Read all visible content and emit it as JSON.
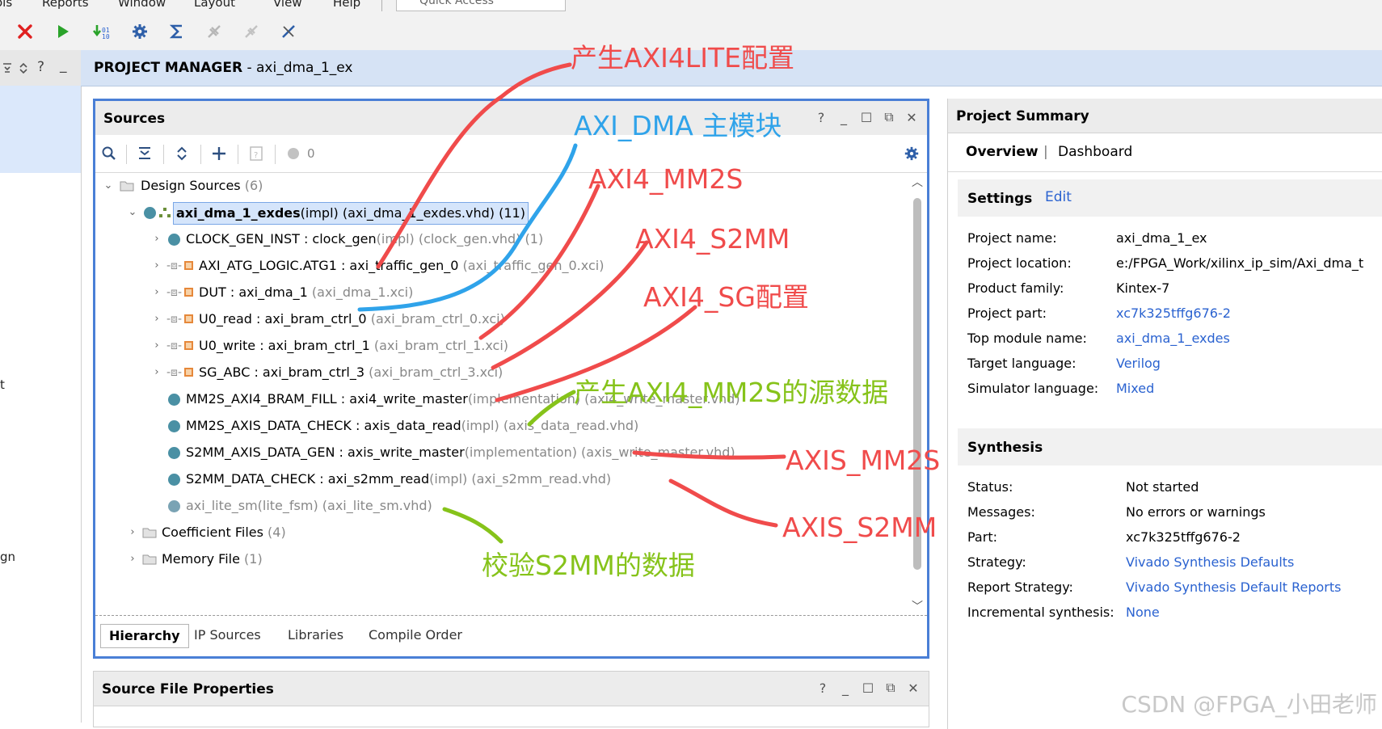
{
  "menu": [
    "Reports",
    "Window",
    "Layout",
    "View",
    "Help"
  ],
  "menu_partial": "ols",
  "quick_access": "Quick Access",
  "pm_header": {
    "title": "PROJECT MANAGER",
    "project": " - axi_dma_1_ex"
  },
  "left_rail": {
    "frag1": "t",
    "frag2": "gn"
  },
  "sources": {
    "title": "Sources",
    "err_count": "0",
    "rows": [
      {
        "name": "Design Sources",
        "extra": " (6)"
      },
      {
        "name": "axi_dma_1_exdes",
        "extra": "(impl) (axi_dma_1_exdes.vhd) (11)"
      },
      {
        "name": "CLOCK_GEN_INST : clock_gen",
        "extra": "(impl) (clock_gen.vhd) (1)"
      },
      {
        "name": "AXI_ATG_LOGIC.ATG1 : axi_traffic_gen_0",
        "extra": " (axi_traffic_gen_0.xci)"
      },
      {
        "name": "DUT : axi_dma_1",
        "extra": " (axi_dma_1.xci)"
      },
      {
        "name": "U0_read : axi_bram_ctrl_0",
        "extra": " (axi_bram_ctrl_0.xci)"
      },
      {
        "name": "U0_write : axi_bram_ctrl_1",
        "extra": " (axi_bram_ctrl_1.xci)"
      },
      {
        "name": "SG_ABC : axi_bram_ctrl_3",
        "extra": " (axi_bram_ctrl_3.xci)"
      },
      {
        "name": "MM2S_AXI4_BRAM_FILL : axi4_write_master",
        "extra": "(implementation) (axi4_write_master.vhd)"
      },
      {
        "name": "MM2S_AXIS_DATA_CHECK : axis_data_read",
        "extra": "(impl) (axis_data_read.vhd)"
      },
      {
        "name": "S2MM_AXIS_DATA_GEN : axis_write_master",
        "extra": "(implementation) (axis_write_master.vhd)"
      },
      {
        "name": "S2MM_DATA_CHECK : axi_s2mm_read",
        "extra": "(impl) (axi_s2mm_read.vhd)"
      },
      {
        "name": "",
        "extra": "axi_lite_sm(lite_fsm) (axi_lite_sm.vhd)"
      },
      {
        "name": "Coefficient Files",
        "extra": " (4)"
      },
      {
        "name": "Memory File",
        "extra": " (1)"
      }
    ],
    "tabs": [
      "Hierarchy",
      "IP Sources",
      "Libraries",
      "Compile Order"
    ]
  },
  "source_file_properties": {
    "title": "Source File Properties"
  },
  "summary": {
    "title": "Project Summary",
    "tab_overview": "Overview",
    "tab_sep": "|",
    "tab_dashboard": "Dashboard",
    "settings": {
      "title": "Settings",
      "edit": "Edit",
      "rows": [
        {
          "k": "Project name:",
          "v": "axi_dma_1_ex"
        },
        {
          "k": "Project location:",
          "v": "e:/FPGA_Work/xilinx_ip_sim/Axi_dma_t"
        },
        {
          "k": "Product family:",
          "v": "Kintex-7"
        },
        {
          "k": "Project part:",
          "v": "xc7k325tffg676-2"
        },
        {
          "k": "Top module name:",
          "v": "axi_dma_1_exdes"
        },
        {
          "k": "Target language:",
          "v": "Verilog"
        },
        {
          "k": "Simulator language:",
          "v": "Mixed"
        }
      ]
    },
    "synthesis": {
      "title": "Synthesis",
      "rows": [
        {
          "k": "Status:",
          "v": "Not started"
        },
        {
          "k": "Messages:",
          "v": "No errors or warnings"
        },
        {
          "k": "Part:",
          "v": "xc7k325tffg676-2"
        },
        {
          "k": "Strategy:",
          "v": "Vivado Synthesis Defaults"
        },
        {
          "k": "Report Strategy:",
          "v": "Vivado Synthesis Default Reports"
        },
        {
          "k": "Incremental synthesis:",
          "v": "None"
        }
      ]
    }
  },
  "annotations": {
    "a1": "产生AXI4LITE配置",
    "a2": "AXI_DMA 主模块",
    "a3": "AXI4_MM2S",
    "a4": "AXI4_S2MM",
    "a5": "AXI4_SG配置",
    "a6": "产生AXI4_MM2S的源数据",
    "a7": "AXIS_MM2S",
    "a8": "AXIS_S2MM",
    "a9": "校验S2MM的数据"
  },
  "watermark": "CSDN @FPGA_小田老师",
  "colors": {
    "accent": "#4a7fd6",
    "link": "#2a62d0",
    "annot_red": "#f04b4b",
    "annot_blue": "#2fa3ea",
    "annot_green": "#86c31a"
  }
}
